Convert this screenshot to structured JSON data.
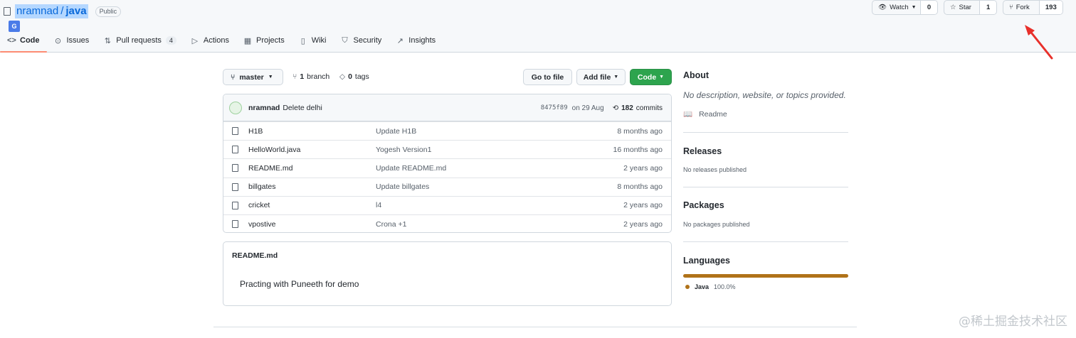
{
  "repo": {
    "owner": "nramnad",
    "separator": "/",
    "name": "java",
    "visibility": "Public"
  },
  "translate_badge": "G",
  "header_actions": {
    "watch": {
      "label": "Watch",
      "count": "0"
    },
    "star": {
      "label": "Star",
      "count": "1"
    },
    "fork": {
      "label": "Fork",
      "count": "193"
    }
  },
  "tabs": [
    {
      "label": "Code",
      "icon": "code-icon",
      "active": true
    },
    {
      "label": "Issues",
      "icon": "issue-icon"
    },
    {
      "label": "Pull requests",
      "icon": "pull-request-icon",
      "counter": "4"
    },
    {
      "label": "Actions",
      "icon": "play-icon"
    },
    {
      "label": "Projects",
      "icon": "project-icon"
    },
    {
      "label": "Wiki",
      "icon": "book-icon"
    },
    {
      "label": "Security",
      "icon": "shield-icon"
    },
    {
      "label": "Insights",
      "icon": "graph-icon"
    }
  ],
  "branch_bar": {
    "branch": "master",
    "branches_count": "1",
    "branches_label": "branch",
    "tags_count": "0",
    "tags_label": "tags",
    "go_to_file": "Go to file",
    "add_file": "Add file",
    "code": "Code"
  },
  "latest_commit": {
    "author": "nramnad",
    "message": "Delete delhi",
    "sha": "8475f89",
    "date": "on 29 Aug",
    "commits_count": "182",
    "commits_label": "commits"
  },
  "files": [
    {
      "name": "H1B",
      "message": "Update H1B",
      "age": "8 months ago"
    },
    {
      "name": "HelloWorld.java",
      "message": "Yogesh Version1",
      "age": "16 months ago"
    },
    {
      "name": "README.md",
      "message": "Update README.md",
      "age": "2 years ago"
    },
    {
      "name": "billgates",
      "message": "Update billgates",
      "age": "8 months ago"
    },
    {
      "name": "cricket",
      "message": "l4",
      "age": "2 years ago"
    },
    {
      "name": "vpostive",
      "message": "Crona +1",
      "age": "2 years ago"
    }
  ],
  "readme": {
    "title": "README.md",
    "body": "Practing with Puneeth for demo"
  },
  "sidebar": {
    "about_title": "About",
    "about_desc": "No description, website, or topics provided.",
    "readme_link": "Readme",
    "releases_title": "Releases",
    "releases_desc": "No releases published",
    "packages_title": "Packages",
    "packages_desc": "No packages published",
    "languages_title": "Languages",
    "languages": [
      {
        "name": "Java",
        "percent": "100.0%",
        "color": "#b07219"
      }
    ]
  },
  "watermark": "@稀土掘金技术社区",
  "colors": {
    "accent": "#0969da",
    "green": "#2da44e",
    "tab_underline": "#fd8c73",
    "annotation": "#e8302a"
  }
}
